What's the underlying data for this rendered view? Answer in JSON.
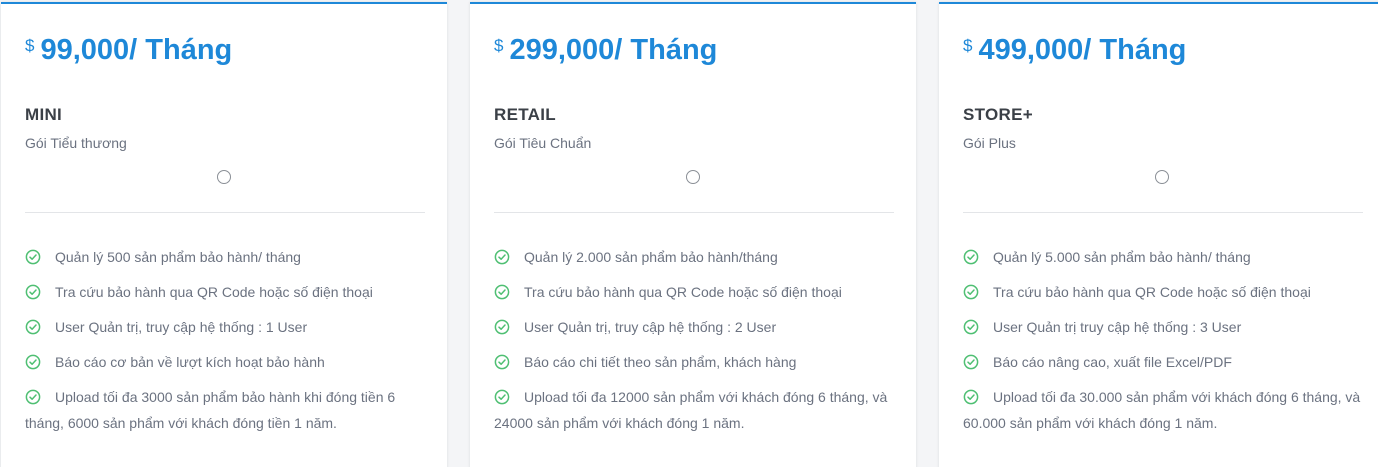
{
  "colors": {
    "accent": "#1e88d8",
    "check": "#4fbf73",
    "text_muted": "#6b7280",
    "heading": "#3b4047"
  },
  "plans": [
    {
      "currency": "$",
      "price": "99,000/ Tháng",
      "name": "MINI",
      "subtitle": "Gói Tiểu thương",
      "features": [
        "Quản lý 500 sản phẩm bảo hành/ tháng",
        "Tra cứu bảo hành qua QR Code hoặc số điện thoại",
        "User Quản trị, truy cập hệ thống : 1 User",
        "Báo cáo cơ bản về lượt kích hoạt bảo hành",
        "Upload tối đa 3000 sản phẩm bảo hành khi đóng tiền 6 tháng, 6000 sản phẩm với khách đóng tiền 1 năm."
      ]
    },
    {
      "currency": "$",
      "price": "299,000/ Tháng",
      "name": "RETAIL",
      "subtitle": "Gói Tiêu Chuẩn",
      "features": [
        "Quản lý 2.000 sản phẩm bảo hành/tháng",
        "Tra cứu bảo hành qua QR Code hoặc số điện thoại",
        "User Quản trị, truy cập hệ thống : 2 User",
        "Báo cáo chi tiết theo sản phẩm, khách hàng",
        "Upload tối đa 12000 sản phẩm với khách đóng 6 tháng, và 24000 sản phẩm với khách đóng 1 năm."
      ]
    },
    {
      "currency": "$",
      "price": "499,000/ Tháng",
      "name": "STORE+",
      "subtitle": "Gói Plus",
      "features": [
        "Quản lý 5.000 sản phẩm bảo hành/ tháng",
        "Tra cứu bảo hành qua QR Code hoặc số điện thoại",
        "User Quản trị truy cập hệ thống : 3 User",
        "Báo cáo nâng cao, xuất file Excel/PDF",
        "Upload tối đa 30.000 sản phẩm với khách đóng 6 tháng, và 60.000 sản phẩm với khách đóng 1 năm."
      ]
    }
  ]
}
